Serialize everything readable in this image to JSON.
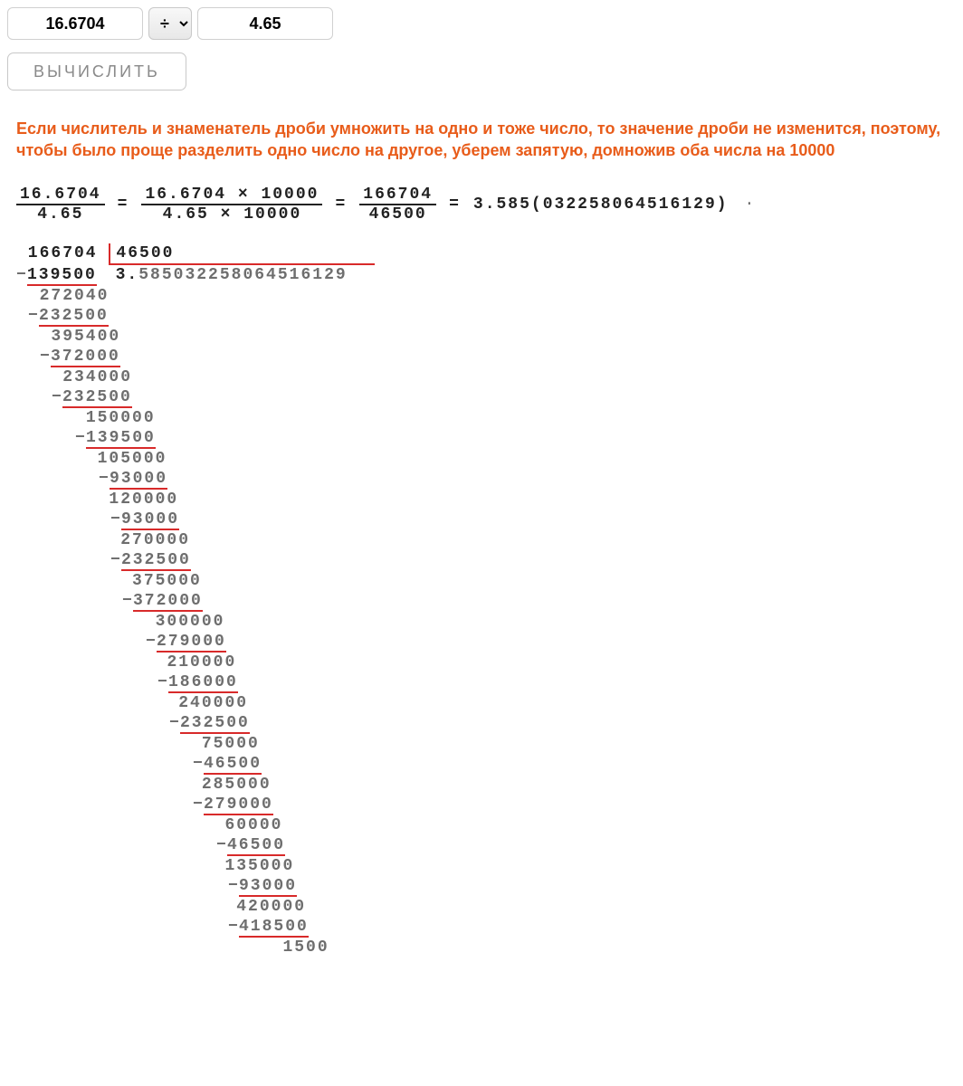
{
  "inputs": {
    "a": "16.6704",
    "op": "÷",
    "b": "4.65"
  },
  "button": {
    "calc": "ВЫЧИСЛИТЬ"
  },
  "explanation": "Если числитель и знаменатель дроби умножить на одно и тоже число, то значение дроби не изменится, поэтому, чтобы было проще разделить одно число на другое, уберем запятую, домножив оба числа на 10000",
  "fracline": {
    "f1n": "16.6704",
    "f1d": "4.65",
    "f2n": "16.6704 × 10000",
    "f2d": "4.65 × 10000",
    "f3n": "166704",
    "f3d": "46500",
    "result": "3.585(032258064516129)"
  },
  "longdiv": {
    "dividend": "166704",
    "divisor": "46500",
    "quotient_int": "3.",
    "quotient_tail": "585032258064516129",
    "steps": [
      {
        "indent": 1,
        "top": "139500",
        "minus": true,
        "underline": true,
        "is_first": true
      },
      {
        "indent": 2,
        "top": "272040"
      },
      {
        "indent": 2,
        "top": "232500",
        "minus": true,
        "underline": true
      },
      {
        "indent": 3,
        "top": "395400"
      },
      {
        "indent": 3,
        "top": "372000",
        "minus": true,
        "underline": true
      },
      {
        "indent": 4,
        "top": "234000"
      },
      {
        "indent": 4,
        "top": "232500",
        "minus": true,
        "underline": true
      },
      {
        "indent": 6,
        "top": "150000"
      },
      {
        "indent": 6,
        "top": "139500",
        "minus": true,
        "underline": true
      },
      {
        "indent": 7,
        "top": "105000"
      },
      {
        "indent": 8,
        "top": "93000",
        "minus": true,
        "underline": true
      },
      {
        "indent": 8,
        "top": "120000"
      },
      {
        "indent": 9,
        "top": "93000",
        "minus": true,
        "underline": true
      },
      {
        "indent": 9,
        "top": "270000"
      },
      {
        "indent": 9,
        "top": "232500",
        "minus": true,
        "underline": true
      },
      {
        "indent": 10,
        "top": "375000"
      },
      {
        "indent": 10,
        "top": "372000",
        "minus": true,
        "underline": true
      },
      {
        "indent": 12,
        "top": "300000"
      },
      {
        "indent": 12,
        "top": "279000",
        "minus": true,
        "underline": true
      },
      {
        "indent": 13,
        "top": "210000"
      },
      {
        "indent": 13,
        "top": "186000",
        "minus": true,
        "underline": true
      },
      {
        "indent": 14,
        "top": "240000"
      },
      {
        "indent": 14,
        "top": "232500",
        "minus": true,
        "underline": true
      },
      {
        "indent": 16,
        "top": "75000"
      },
      {
        "indent": 16,
        "top": "46500",
        "minus": true,
        "underline": true
      },
      {
        "indent": 16,
        "top": "285000"
      },
      {
        "indent": 16,
        "top": "279000",
        "minus": true,
        "underline": true
      },
      {
        "indent": 18,
        "top": "60000"
      },
      {
        "indent": 18,
        "top": "46500",
        "minus": true,
        "underline": true
      },
      {
        "indent": 18,
        "top": "135000"
      },
      {
        "indent": 19,
        "top": "93000",
        "minus": true,
        "underline": true
      },
      {
        "indent": 19,
        "top": "420000"
      },
      {
        "indent": 19,
        "top": "418500",
        "minus": true,
        "underline": true
      },
      {
        "indent": 23,
        "top": "1500",
        "final": true
      }
    ]
  }
}
